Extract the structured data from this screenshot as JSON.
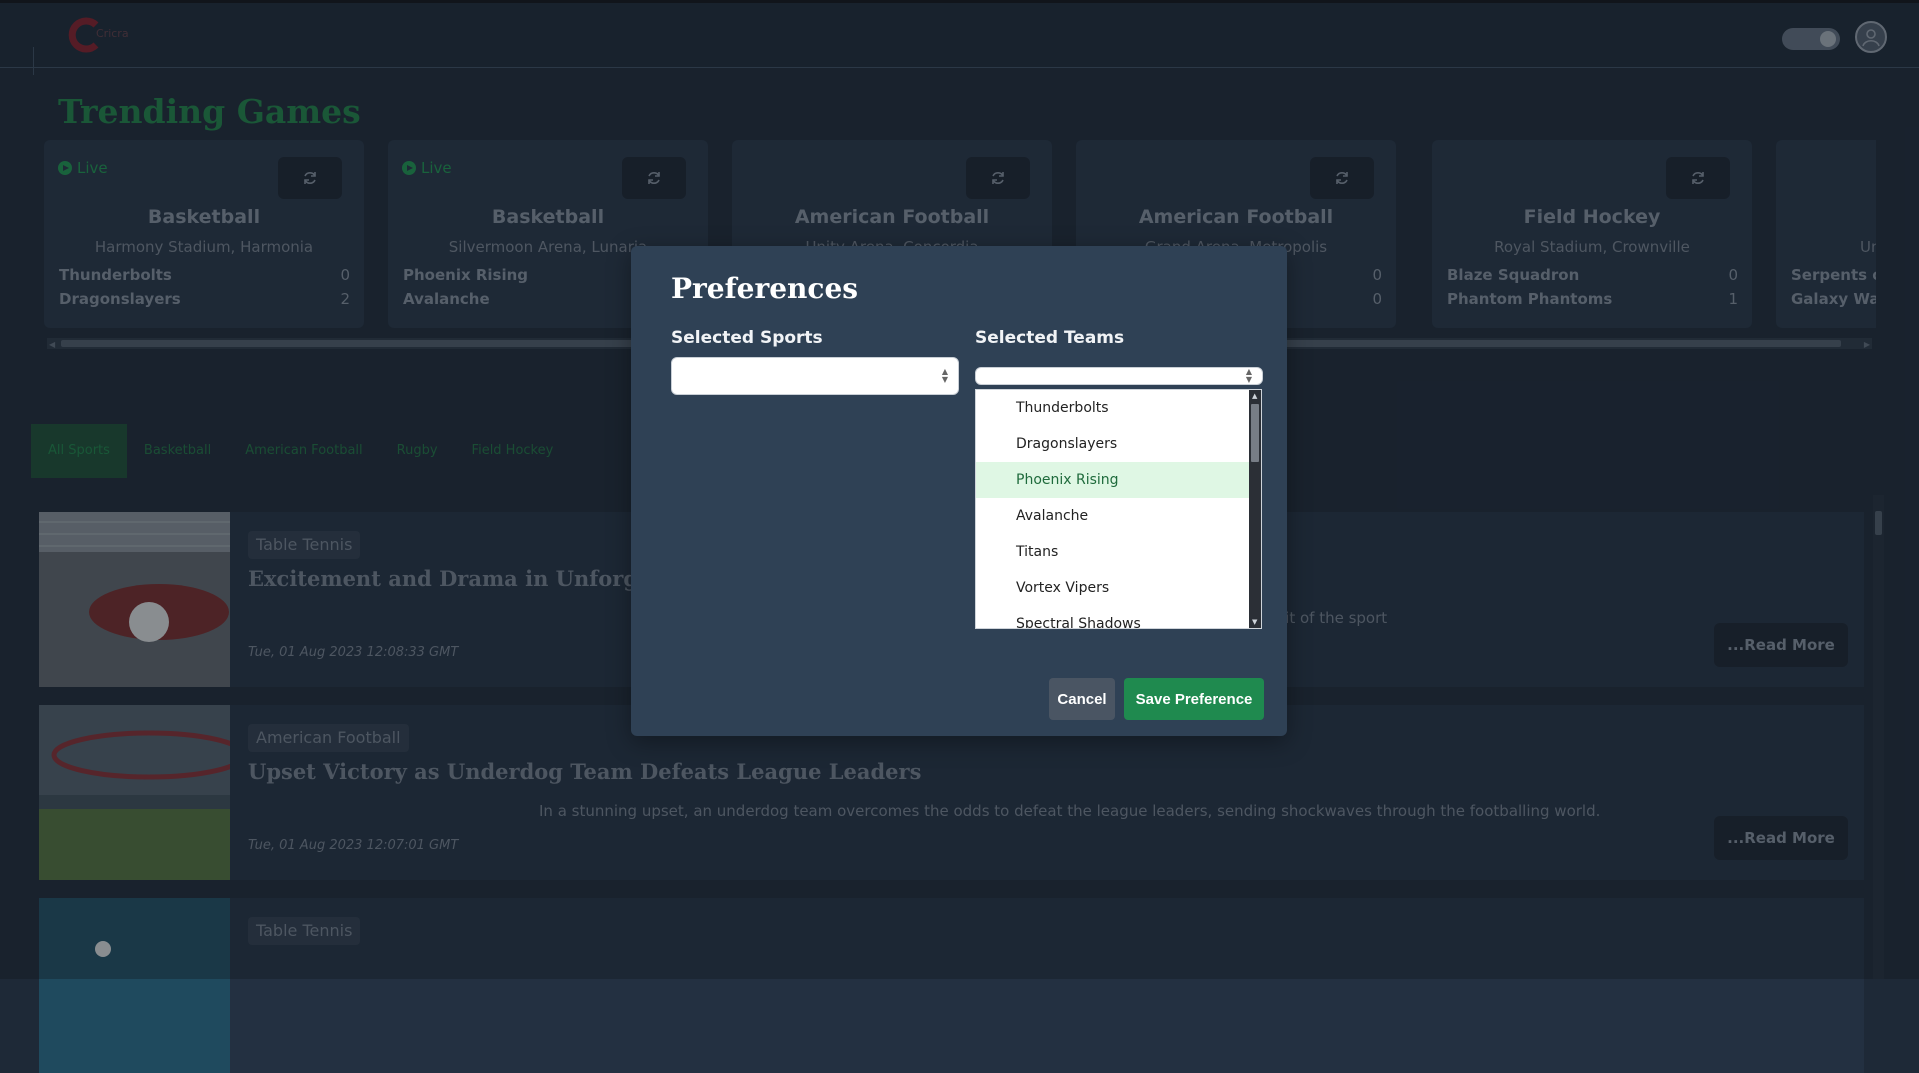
{
  "navbar": {
    "logo_text": "Cricra"
  },
  "trending": {
    "title": "Trending Games",
    "live_label": "Live",
    "games": [
      {
        "live": true,
        "sport": "Basketball",
        "venue": "Harmony Stadium, Harmonia",
        "team1": "Thunderbolts",
        "score1": "0",
        "team2": "Dragonslayers",
        "score2": "2"
      },
      {
        "live": true,
        "sport": "Basketball",
        "venue": "Silvermoon Arena, Lunaria",
        "team1": "Phoenix Rising",
        "score1": "",
        "team2": "Avalanche",
        "score2": ""
      },
      {
        "live": false,
        "sport": "American Football",
        "venue": "Unity Arena, Concordia",
        "team1": "",
        "score1": "",
        "team2": "",
        "score2": ""
      },
      {
        "live": false,
        "sport": "American Football",
        "venue": "Grand Arena, Metropolis",
        "team1": "",
        "score1": "0",
        "team2": "",
        "score2": "0"
      },
      {
        "live": false,
        "sport": "Field Hockey",
        "venue": "Royal Stadium, Crownville",
        "team1": "Blaze Squadron",
        "score1": "0",
        "team2": "Phantom Phantoms",
        "score2": "1"
      },
      {
        "live": false,
        "sport": "",
        "venue": "Un",
        "team1": "Serpents o",
        "score1": "",
        "team2": "Galaxy Wa",
        "score2": ""
      }
    ]
  },
  "filters": [
    "All Sports",
    "Basketball",
    "American Football",
    "Rugby",
    "Field Hockey"
  ],
  "news": [
    {
      "tag": "Table Tennis",
      "headline": "Excitement and Drama in Unforgetta",
      "snippet": "rit of the sport",
      "date": "Tue, 01 Aug 2023 12:08:33 GMT",
      "read_more": "...Read More"
    },
    {
      "tag": "American Football",
      "headline": "Upset Victory as Underdog Team Defeats League Leaders",
      "snippet": "In a stunning upset, an underdog team overcomes the odds to defeat the league leaders, sending shockwaves through the footballing world.",
      "date": "Tue, 01 Aug 2023 12:07:01 GMT",
      "read_more": "...Read More"
    },
    {
      "tag": "Table Tennis",
      "headline": "",
      "snippet": "",
      "date": "",
      "read_more": ""
    }
  ],
  "modal": {
    "title": "Preferences",
    "sports_label": "Selected Sports",
    "teams_label": "Selected Teams",
    "team_options": [
      "Thunderbolts",
      "Dragonslayers",
      "Phoenix Rising",
      "Avalanche",
      "Titans",
      "Vortex Vipers",
      "Spectral Shadows"
    ],
    "selected_option": "Phoenix Rising",
    "cancel_label": "Cancel",
    "save_label": "Save Preference"
  },
  "colors": {
    "accent_green": "#1f8a4f",
    "background": "#1e2937",
    "modal": "#2f4155"
  }
}
